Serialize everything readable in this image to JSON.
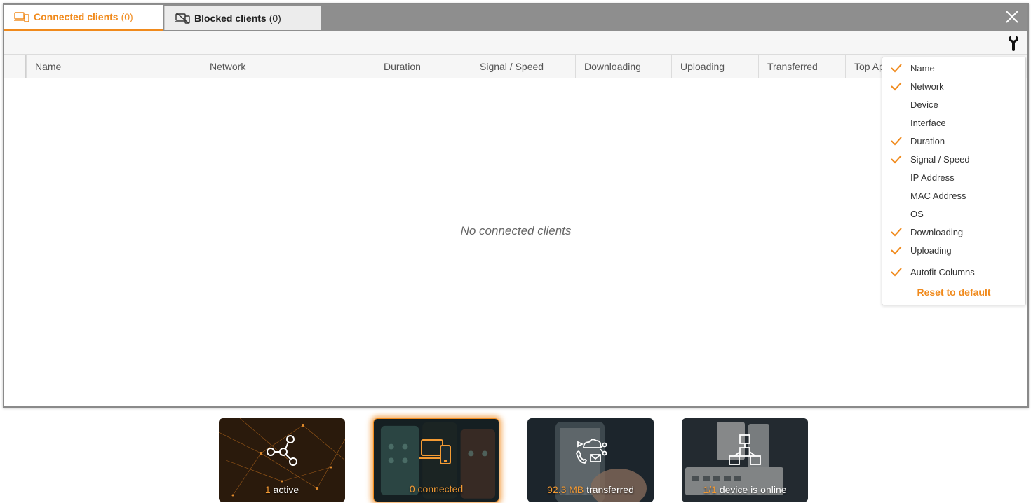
{
  "tabs": [
    {
      "label": "Connected clients",
      "count": "(0)"
    },
    {
      "label": "Blocked clients",
      "count": "(0)"
    }
  ],
  "columns": [
    "Name",
    "Network",
    "Duration",
    "Signal / Speed",
    "Downloading",
    "Uploading",
    "Transferred",
    "Top Ap"
  ],
  "empty_message": "No connected clients",
  "column_menu": {
    "items": [
      {
        "label": "Name",
        "checked": true
      },
      {
        "label": "Network",
        "checked": true
      },
      {
        "label": "Device",
        "checked": false
      },
      {
        "label": "Interface",
        "checked": false
      },
      {
        "label": "Duration",
        "checked": true
      },
      {
        "label": "Signal / Speed",
        "checked": true
      },
      {
        "label": "IP Address",
        "checked": false
      },
      {
        "label": "MAC Address",
        "checked": false
      },
      {
        "label": "OS",
        "checked": false
      },
      {
        "label": "Downloading",
        "checked": true
      },
      {
        "label": "Uploading",
        "checked": true
      }
    ],
    "autofit": {
      "label": "Autofit Columns",
      "checked": true
    },
    "reset_label": "Reset to default"
  },
  "tiles": [
    {
      "number": "1",
      "text": "active",
      "icon": "network-nodes-icon"
    },
    {
      "number": "0",
      "text": "connected",
      "icon": "devices-icon"
    },
    {
      "number": "92.3 MB",
      "text": "transferred",
      "icon": "cloud-share-icon"
    },
    {
      "number": "1/1",
      "text": "device is online",
      "icon": "topology-icon"
    }
  ],
  "colors": {
    "accent": "#f08a1c",
    "tabbar": "#8e8e8e",
    "header_bg": "#f6f6f6"
  }
}
